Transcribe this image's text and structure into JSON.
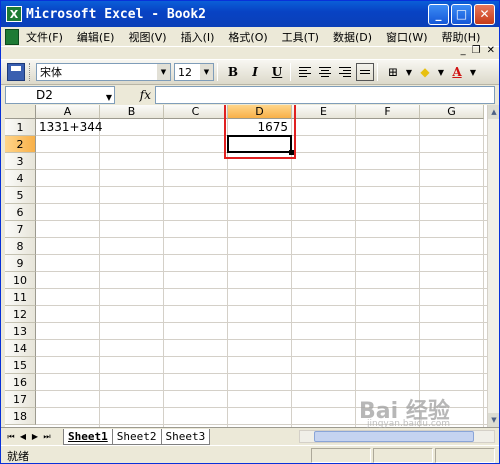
{
  "window": {
    "title": "Microsoft Excel - Book2",
    "icon_letter": "X"
  },
  "menu": {
    "items": [
      "文件(F)",
      "编辑(E)",
      "视图(V)",
      "插入(I)",
      "格式(O)",
      "工具(T)",
      "数据(D)",
      "窗口(W)",
      "帮助(H)"
    ]
  },
  "toolbar": {
    "font_name": "宋体",
    "font_size": "12",
    "bold": "B",
    "italic": "I",
    "underline": "U",
    "font_color_letter": "A"
  },
  "formula_bar": {
    "name_box": "D2",
    "fx_label": "fx",
    "content": ""
  },
  "columns": [
    "A",
    "B",
    "C",
    "D",
    "E",
    "F",
    "G"
  ],
  "rows": [
    "1",
    "2",
    "3",
    "4",
    "5",
    "6",
    "7",
    "8",
    "9",
    "10",
    "11",
    "12",
    "13",
    "14",
    "15",
    "16",
    "17",
    "18"
  ],
  "cells": {
    "A1": "1331+344",
    "D1": "1675"
  },
  "active_cell": "D2",
  "sheets": [
    "Sheet1",
    "Sheet2",
    "Sheet3"
  ],
  "active_sheet": "Sheet1",
  "status": {
    "text": "就绪"
  },
  "watermark": {
    "main": "Bai 经验",
    "sub": "jingyan.baidu.com"
  },
  "colors": {
    "highlight_box": "#e02020",
    "active_header": "#f8b048",
    "title_bar": "#0843c4"
  }
}
